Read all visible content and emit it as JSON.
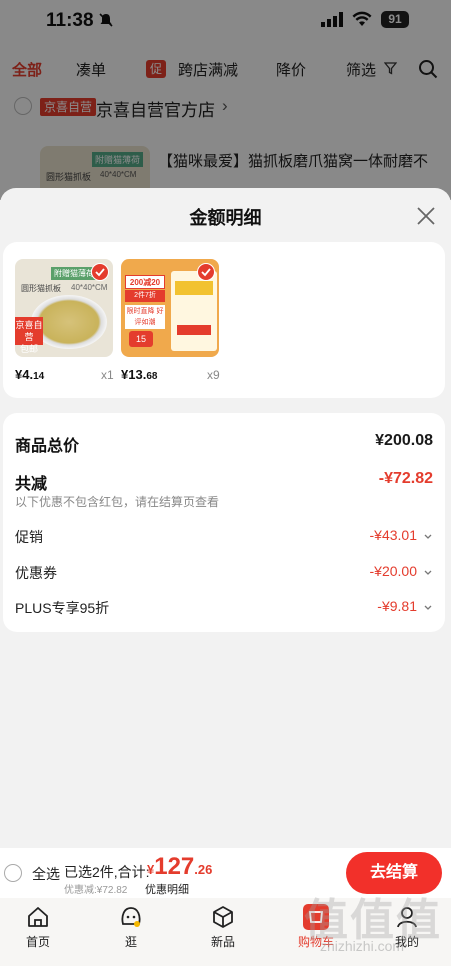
{
  "status_bar": {
    "time": "11:38",
    "battery": "91"
  },
  "filter_bar": {
    "items": [
      "全部",
      "凑单",
      "促",
      "跨店满减",
      "降价",
      "筛选"
    ]
  },
  "store": {
    "badge": "京喜自营",
    "name": "京喜自营官方店",
    "chevron": "›"
  },
  "bg_product": {
    "thumb_tag": "附赠猫薄荷",
    "thumb_label": "圆形猫抓板",
    "thumb_size": "40*40*CM",
    "title": "【猫咪最爱】猫抓板磨爪猫窝一体耐磨不"
  },
  "sheet": {
    "title": "金额明细",
    "items": [
      {
        "tag": "附赠猫薄荷",
        "label": "圆形猫抓板",
        "size": "40*40*CM",
        "badge_line1": "京喜自营",
        "badge_line2": "包邮",
        "price_int": "¥4.",
        "price_dec": "14",
        "qty": "x1"
      },
      {
        "promo1": "200减20",
        "promo2": "2件7折",
        "promo3": "限时直降 好评如潮",
        "promo4": "15",
        "price_int": "¥13.",
        "price_dec": "68",
        "qty": "x9"
      }
    ],
    "summary": {
      "total_label": "商品总价",
      "total_value": "¥200.08",
      "reduce_label": "共减",
      "reduce_value": "-¥72.82",
      "note": "以下优惠不包含红包，请在结算页查看",
      "rows": [
        {
          "label": "促销",
          "value": "-¥43.01"
        },
        {
          "label": "优惠券",
          "value": "-¥20.00"
        },
        {
          "label": "PLUS专享95折",
          "value": "-¥9.81"
        }
      ]
    }
  },
  "checkout": {
    "select_all": "全选",
    "selected": "已选2件,合计:",
    "currency": "¥",
    "amount_int": "127",
    "amount_dec": ".26",
    "saving": "优惠减:¥72.82",
    "detail": "优惠明细",
    "button": "去结算"
  },
  "tabbar": {
    "items": [
      "首页",
      "逛",
      "新品",
      "购物车",
      "我的"
    ],
    "active": "购物车"
  },
  "watermark": {
    "text": "值值值",
    "url": "zhizhizhi.com"
  },
  "colors": {
    "accent": "#e43c2d",
    "button": "#f2302a"
  }
}
